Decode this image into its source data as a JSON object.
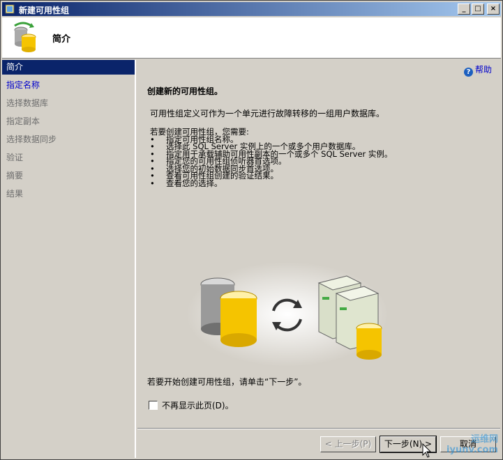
{
  "window": {
    "title": "新建可用性组"
  },
  "titlebar_buttons": [
    "_",
    "□",
    "×"
  ],
  "header": {
    "title": "简介"
  },
  "nav": {
    "items": [
      {
        "label": "简介",
        "state": "selected"
      },
      {
        "label": "指定名称",
        "state": "link"
      },
      {
        "label": "选择数据库",
        "state": "disabled"
      },
      {
        "label": "指定副本",
        "state": "disabled"
      },
      {
        "label": "选择数据同步",
        "state": "disabled"
      },
      {
        "label": "验证",
        "state": "disabled"
      },
      {
        "label": "摘要",
        "state": "disabled"
      },
      {
        "label": "结果",
        "state": "disabled"
      }
    ]
  },
  "help": {
    "label": "帮助"
  },
  "content": {
    "title": "创建新的可用性组。",
    "description": "可用性组定义可作为一个单元进行故障转移的一组用户数据库。",
    "needs_intro": "若要创建可用性组，您需要:",
    "needs": [
      "指定可用性组名称。",
      "选择此 SQL Server 实例上的一个或多个用户数据库。",
      "指定用于承载辅助可用性副本的一个或多个 SQL Server 实例。",
      "指定您的可用性组侦听器首选项。",
      "选择您的初始数据同步首选项。",
      "查看可用性组创建的验证结果。",
      "查看您的选择。"
    ],
    "begin_text": "若要开始创建可用性组，请单击“下一步”。",
    "dont_show_label": "不再显示此页(D)。",
    "dont_show_checked": false
  },
  "buttons": {
    "prev": "< 上一步(P)",
    "next": "下一步(N) >",
    "cancel": "取消"
  },
  "watermark": {
    "line1": "运维网",
    "line2": "iyunv.com"
  }
}
